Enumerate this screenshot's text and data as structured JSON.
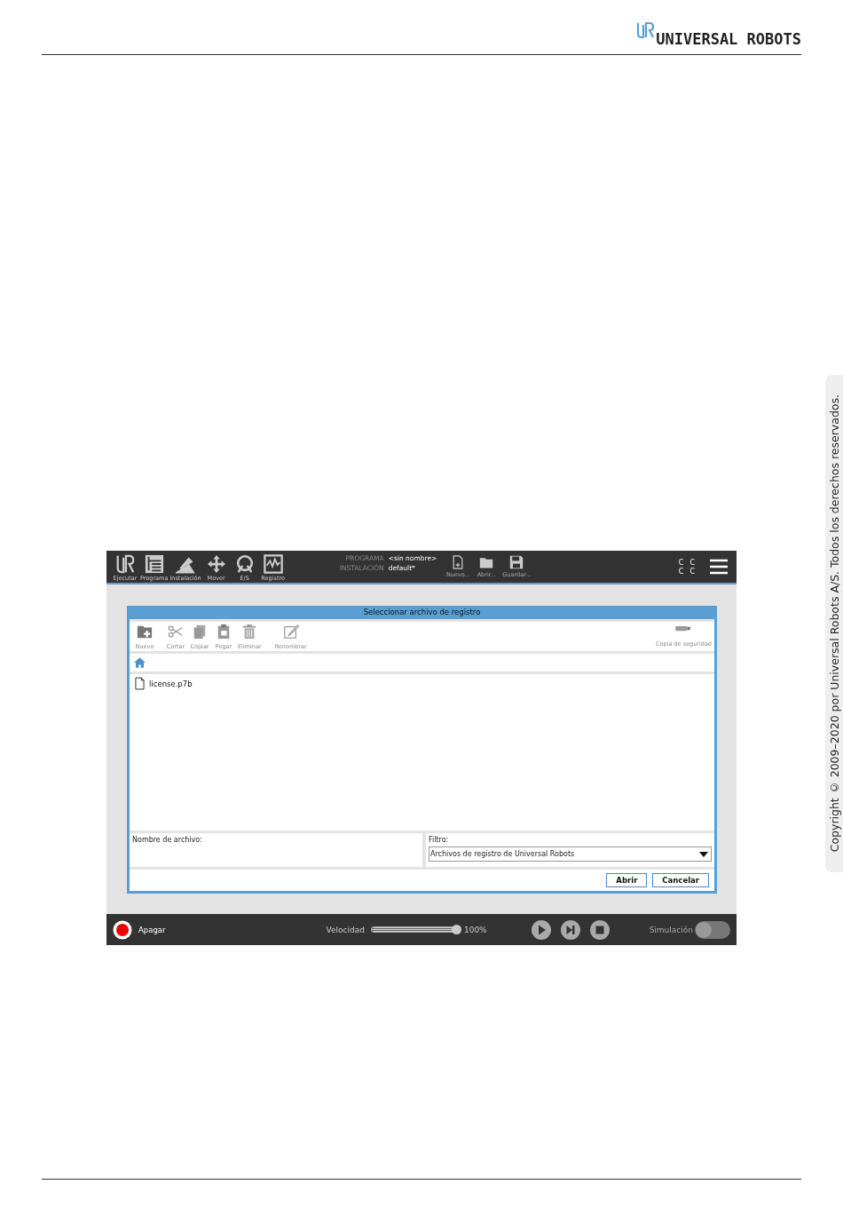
{
  "header": {
    "brand": "UNIVERSAL ROBOTS"
  },
  "side_tab": {
    "text": "Copyright © 2009–2020 por Universal Robots A/S. Todos los derechos reservados."
  },
  "screen": {
    "top_nav": [
      {
        "label": "Ejecutar",
        "kind": "run"
      },
      {
        "label": "Programa",
        "kind": "program"
      },
      {
        "label": "Instalación",
        "kind": "install"
      },
      {
        "label": "Mover",
        "kind": "move"
      },
      {
        "label": "E/S",
        "kind": "io"
      },
      {
        "label": "Registro",
        "kind": "log"
      }
    ],
    "program": {
      "label": "PROGRAMA",
      "value": "<sin nombre>"
    },
    "installation": {
      "label": "INSTALACIÓN",
      "value": "default*"
    },
    "file_actions": [
      {
        "label": "Nuevo...",
        "kind": "new"
      },
      {
        "label": "Abrir...",
        "kind": "open"
      },
      {
        "label": "Guardar...",
        "kind": "save"
      }
    ],
    "status_letters": [
      "C",
      "C",
      "C",
      "C"
    ],
    "dialog": {
      "title": "Seleccionar archivo de registro",
      "toolbar": [
        {
          "label": "Nuevo",
          "kind": "new-folder"
        },
        {
          "label": "Cortar",
          "kind": "cut"
        },
        {
          "label": "Copiar",
          "kind": "copy"
        },
        {
          "label": "Pegar",
          "kind": "paste"
        },
        {
          "label": "Eliminar",
          "kind": "delete"
        },
        {
          "label": "Renombrar",
          "kind": "rename"
        }
      ],
      "backup": {
        "label": "Copia de seguridad"
      },
      "files": [
        {
          "name": "license.p7b"
        }
      ],
      "filename_field": {
        "label": "Nombre de archivo:"
      },
      "filter": {
        "label": "Filtro:",
        "value": "Archivos de registro de Universal Robots"
      },
      "buttons": [
        "Abrir",
        "Cancelar"
      ]
    },
    "bottom_bar": {
      "power": "Apagar",
      "speed_label": "Velocidad",
      "speed": {
        "level": 1.0,
        "reading": "100%"
      },
      "controls": [
        {
          "kind": "play"
        },
        {
          "kind": "step"
        },
        {
          "kind": "stop"
        }
      ],
      "simulation": {
        "label": "Simulación",
        "on": false
      }
    }
  }
}
